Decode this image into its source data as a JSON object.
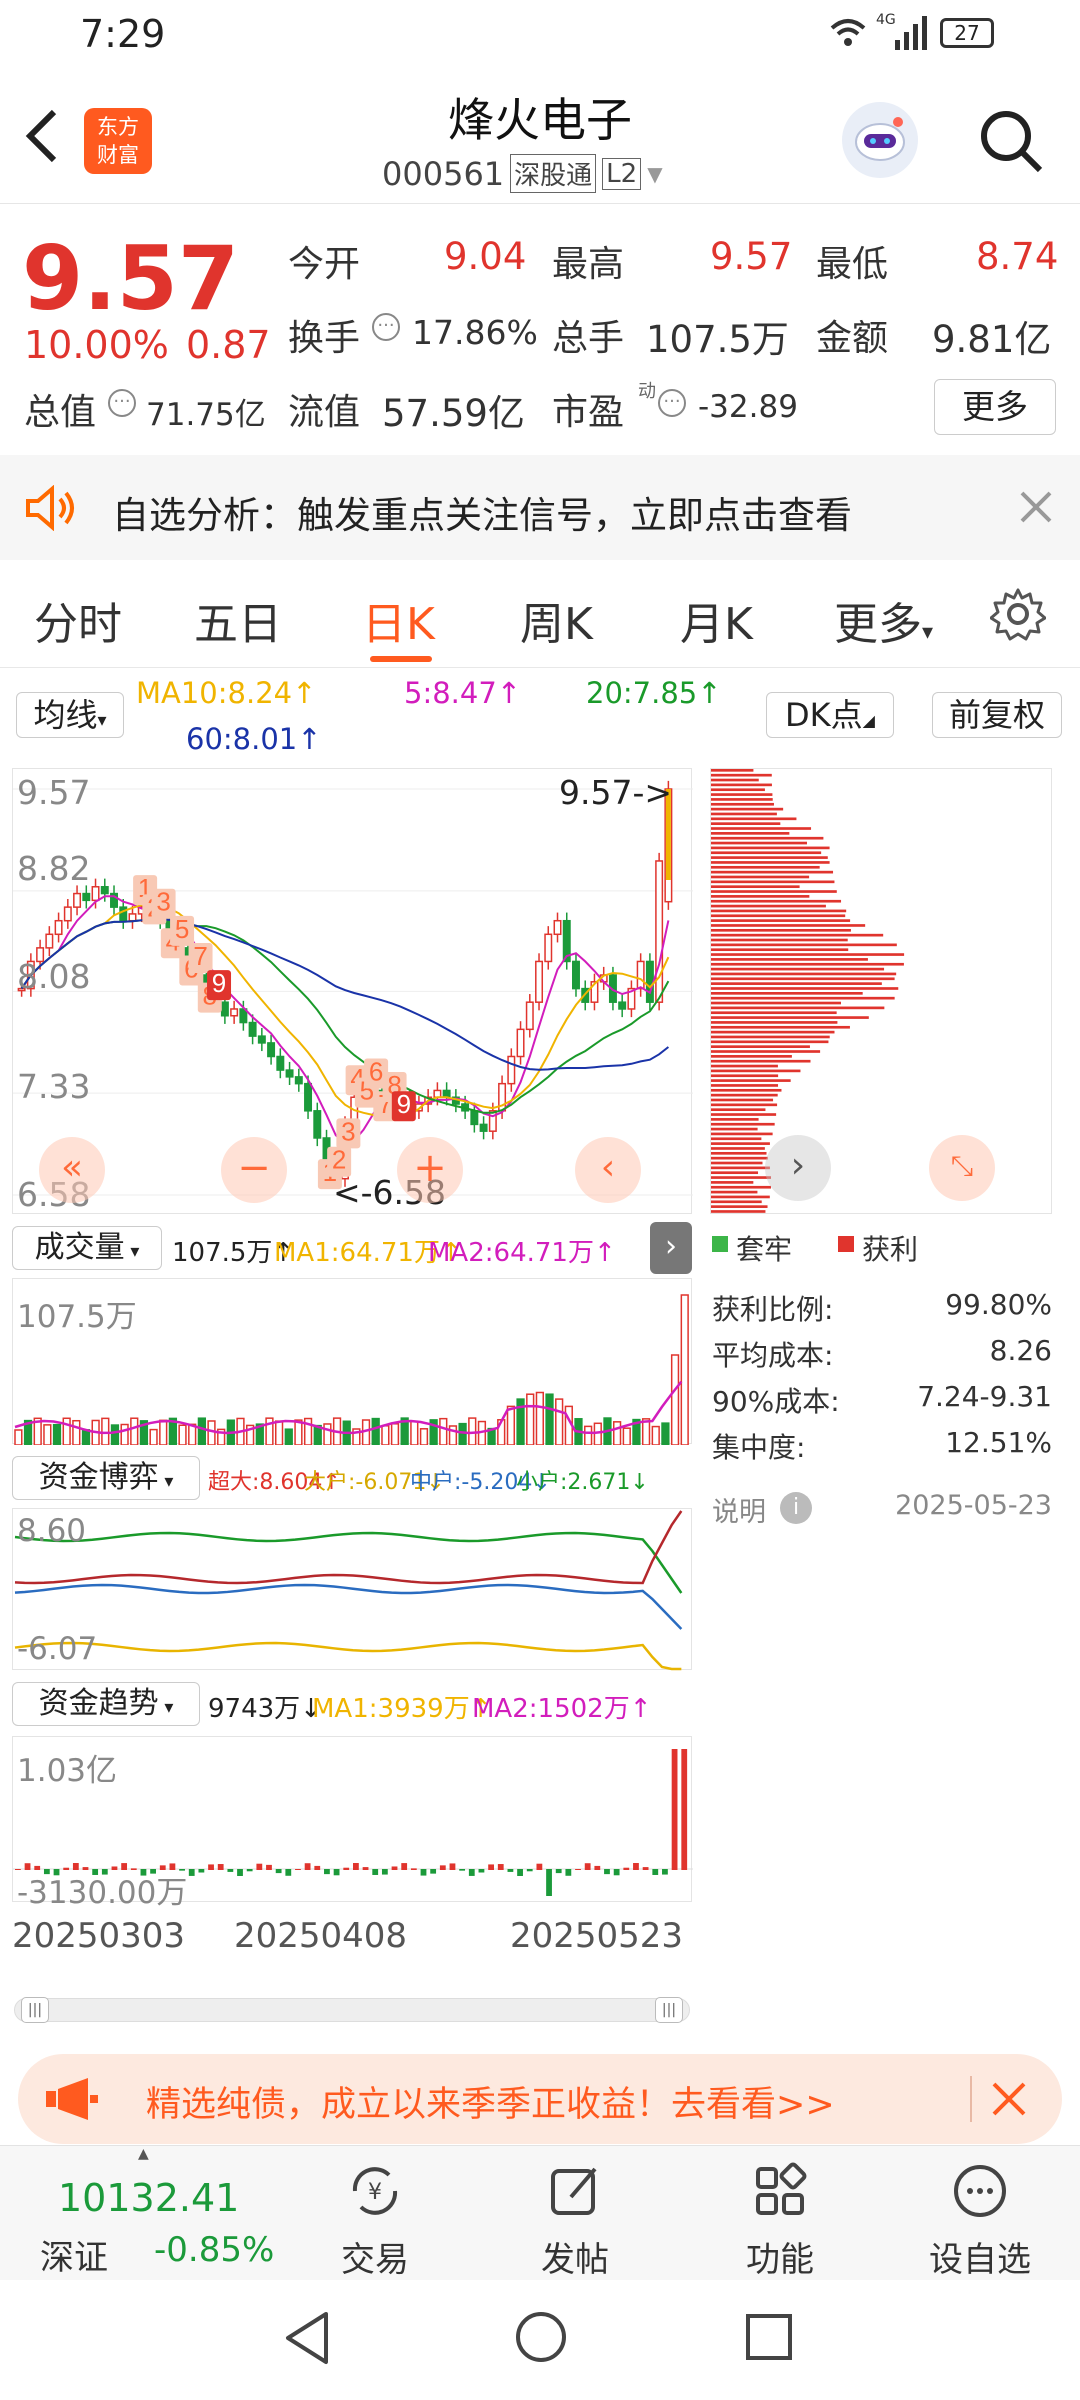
{
  "status_bar": {
    "time": "7:29",
    "network": "4G",
    "battery": "27"
  },
  "header": {
    "logo_line1": "东方",
    "logo_line2": "财富",
    "title": "烽火电子",
    "code": "000561",
    "tag1": "深股通",
    "tag2": "L2"
  },
  "quote": {
    "price": "9.57",
    "change_pct": "10.00%",
    "change": "0.87",
    "open_label": "今开",
    "open": "9.04",
    "high_label": "最高",
    "high": "9.57",
    "low_label": "最低",
    "low": "8.74",
    "turnover_label": "换手",
    "turnover": "17.86%",
    "volume_label": "总手",
    "volume": "107.5万",
    "amount_label": "金额",
    "amount": "9.81亿",
    "mcap_label": "总值",
    "mcap": "71.75亿",
    "float_label": "流值",
    "float": "57.59亿",
    "pe_label": "市盈",
    "pe_sup": "动",
    "pe": "-32.89",
    "more_label": "更多"
  },
  "banner": {
    "text": "自选分析：触发重点关注信号，立即点击查看"
  },
  "tabs": [
    "分时",
    "五日",
    "日K",
    "周K",
    "月K",
    "更多"
  ],
  "active_tab": "日K",
  "ma_bar": {
    "select": "均线",
    "ma10": "MA10:8.24",
    "ma5": "5:8.47",
    "ma20": "20:7.85",
    "ma60": "60:8.01",
    "dk": "DK点",
    "fq": "前复权"
  },
  "kline": {
    "y_labels": [
      "9.57",
      "8.82",
      "8.08",
      "7.33",
      "6.58"
    ],
    "max_tag": "9.57->",
    "min_tag": "<-6.58",
    "signal_digits": [
      "1",
      "2",
      "3",
      "4",
      "5",
      "6",
      "7",
      "8",
      "9",
      "1",
      "2",
      "3",
      "4",
      "5",
      "6",
      "7",
      "8",
      "9"
    ],
    "ctrl_icons": [
      "double-left-icon",
      "minus-icon",
      "plus-icon",
      "chevron-left-icon"
    ]
  },
  "chip_dist": {
    "legend_trap": "套牢",
    "legend_profit": "获利",
    "rows": [
      {
        "label": "获利比例:",
        "value": "99.80%"
      },
      {
        "label": "平均成本:",
        "value": "8.26"
      },
      {
        "label": "90%成本:",
        "value": "7.24-9.31"
      },
      {
        "label": "集中度:",
        "value": "12.51%"
      }
    ],
    "note_label": "说明",
    "date": "2025-05-23"
  },
  "volume_panel": {
    "select": "成交量",
    "vol": "107.5万↑",
    "ma1": "MA1:64.71万↑",
    "ma2": "MA2:64.71万↑",
    "y_top": "107.5万"
  },
  "fund_panel": {
    "select": "资金博弈",
    "super": "超大:8.604↑",
    "big": "大户:-6.071↓",
    "mid": "中户:-5.204↓",
    "small": "小户:2.671↓",
    "y_top": "8.60",
    "y_bottom": "-6.07"
  },
  "trend_panel": {
    "select": "资金趋势",
    "value": "9743万↓",
    "ma1": "MA1:3939万↑",
    "ma2": "MA2:1502万↑",
    "y_top": "1.03亿",
    "y_bottom": "-3130.00万"
  },
  "dates": [
    "20250303",
    "20250408",
    "20250523"
  ],
  "promo": {
    "text": "精选纯债，成立以来季季正收益！去看看>>"
  },
  "bottom_nav": {
    "index_value": "10132.41",
    "index_name": "深证",
    "index_change": "-0.85%",
    "items": [
      "交易",
      "发帖",
      "功能",
      "设自选"
    ]
  },
  "colors": {
    "up": "#e0342d",
    "down": "#1b9a3a",
    "accent": "#ff6a00",
    "ma10": "#f0b400",
    "ma5": "#d21dbc",
    "ma20": "#1a9a2a",
    "ma60": "#1a33a8"
  },
  "chart_data": [
    {
      "type": "candlestick",
      "title": "",
      "y_labels": [
        "9.57",
        "8.82",
        "8.08",
        "7.33",
        "6.58"
      ],
      "ylim": [
        6.58,
        9.57
      ],
      "x_labels": [
        "20250303",
        "20250408",
        "20250523"
      ],
      "last_close": 9.57,
      "high": 9.57,
      "low": 6.58,
      "series": [
        {
          "name": "MA10",
          "last": 8.24
        },
        {
          "name": "MA5",
          "last": 8.47
        },
        {
          "name": "MA20",
          "last": 7.85
        },
        {
          "name": "MA60",
          "last": 8.01
        }
      ]
    },
    {
      "type": "bar",
      "title": "成交量",
      "last_volume": "107.5万",
      "ymax_label": "107.5万",
      "series": [
        {
          "name": "MA1",
          "last": "64.71万"
        },
        {
          "name": "MA2",
          "last": "64.71万"
        }
      ]
    },
    {
      "type": "line",
      "title": "资金博弈",
      "ylim": [
        -6.07,
        8.6
      ],
      "series": [
        {
          "name": "超大",
          "last": 8.604
        },
        {
          "name": "大户",
          "last": -6.071
        },
        {
          "name": "中户",
          "last": -5.204
        },
        {
          "name": "小户",
          "last": 2.671
        }
      ]
    },
    {
      "type": "bar",
      "title": "资金趋势",
      "y_labels": [
        "1.03亿",
        "-3130.00万"
      ],
      "last_value": "9743万",
      "series": [
        {
          "name": "MA1",
          "last": "3939万"
        },
        {
          "name": "MA2",
          "last": "1502万"
        }
      ]
    },
    {
      "type": "bar",
      "title": "",
      "orientation": "horizontal",
      "legend": [
        "套牢",
        "获利"
      ],
      "stats": {
        "获利比例": "99.80%",
        "平均成本": "8.26",
        "90%成本": "7.24-9.31",
        "集中度": "12.51%"
      }
    }
  ]
}
